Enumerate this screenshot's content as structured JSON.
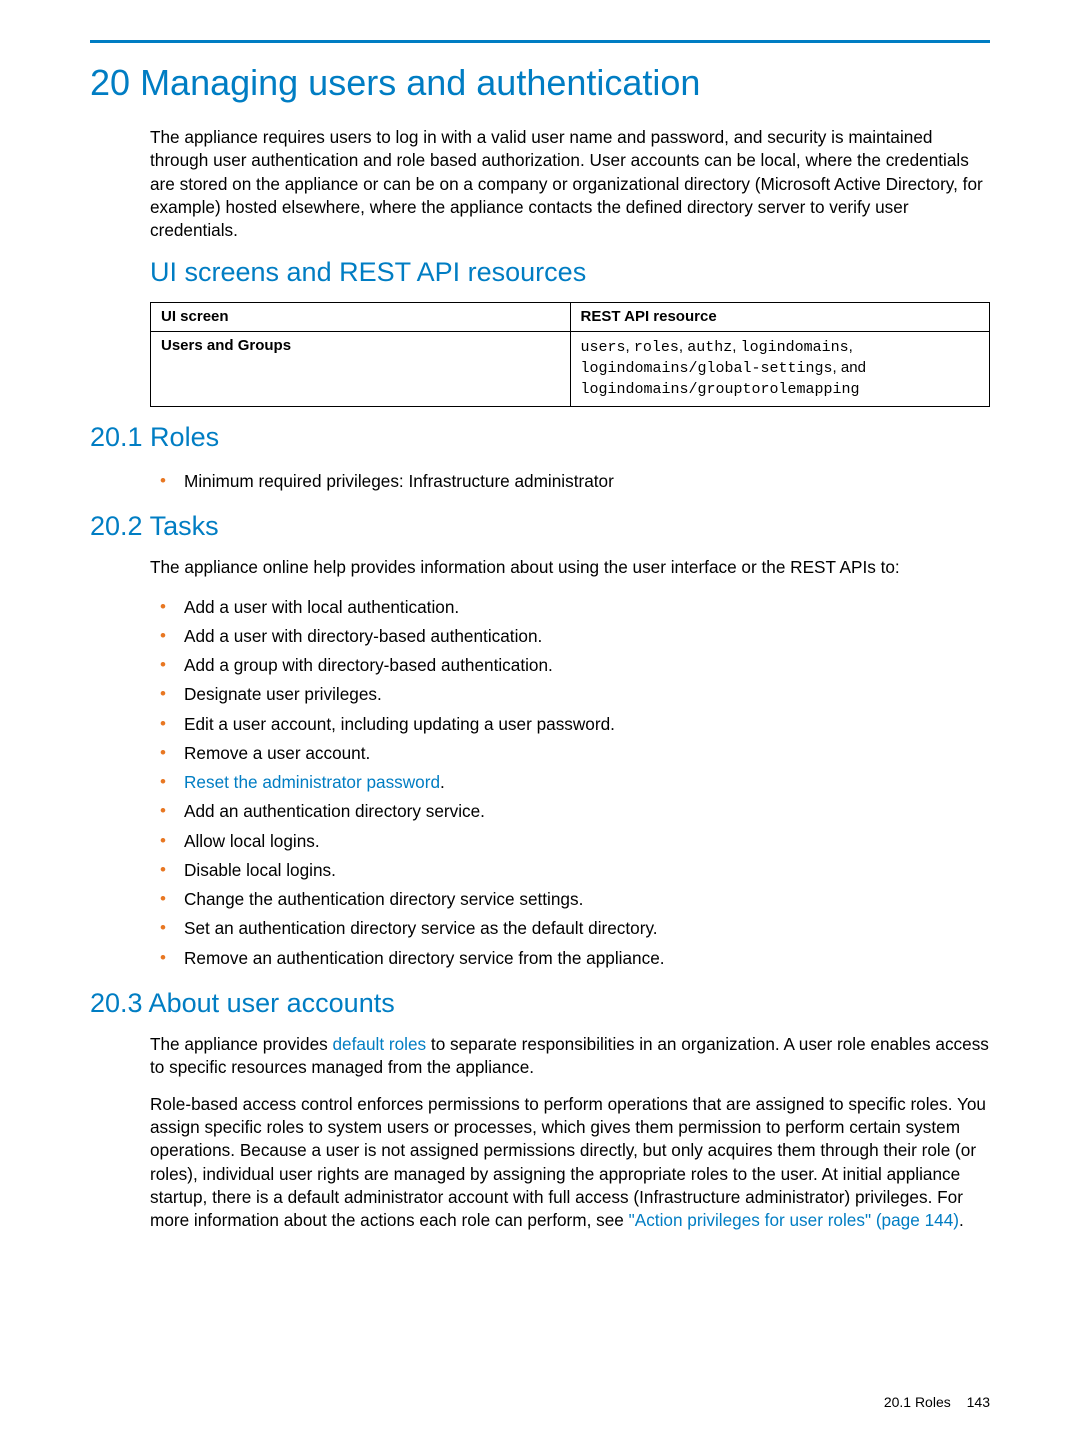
{
  "chapter": {
    "number": "20",
    "title": "Managing users and authentication"
  },
  "intro": "The appliance requires users to log in with a valid user name and password, and security is maintained through user authentication and role based authorization. User accounts can be local, where the credentials are stored on the appliance or can be on a company or organizational directory (Microsoft Active Directory, for example) hosted elsewhere, where the appliance contacts the defined directory server to verify user credentials.",
  "ui_rest_heading": "UI screens and REST API resources",
  "table": {
    "headers": {
      "ui": "UI screen",
      "rest": "REST API resource"
    },
    "row": {
      "ui": "Users and Groups",
      "rest_pre": "users",
      "rest_c1": ", ",
      "rest_r2": "roles",
      "rest_c2": ", ",
      "rest_r3": "authz",
      "rest_c3": ", ",
      "rest_r4": "logindomains",
      "rest_c4": ", ",
      "rest_r5": "logindomains/global-settings",
      "rest_c5": ", and ",
      "rest_r6": "logindomains/grouptorolemapping"
    }
  },
  "roles": {
    "heading": "20.1 Roles",
    "bullet": "Minimum required privileges: Infrastructure administrator"
  },
  "tasks": {
    "heading": "20.2 Tasks",
    "intro": "The appliance online help provides information about using the user interface or the REST APIs to:",
    "items": {
      "i0": "Add a user with local authentication.",
      "i1": "Add a user with directory-based authentication.",
      "i2": "Add a group with directory-based authentication.",
      "i3": "Designate user privileges.",
      "i4": "Edit a user account, including updating a user password.",
      "i5": "Remove a user account.",
      "i6_link": "Reset the administrator password",
      "i6_after": ".",
      "i7": "Add an authentication directory service.",
      "i8": "Allow local logins.",
      "i9": "Disable local logins.",
      "i10": "Change the authentication directory service settings.",
      "i11": "Set an authentication directory service as the default directory.",
      "i12": "Remove an authentication directory service from the appliance."
    }
  },
  "about": {
    "heading": "20.3 About user accounts",
    "p1_pre": "The appliance provides ",
    "p1_link": "default roles",
    "p1_post": " to separate responsibilities in an organization. A user role enables access to specific resources managed from the appliance.",
    "p2_pre": "Role-based access control enforces permissions to perform operations that are assigned to specific roles. You assign specific roles to system users or processes, which gives them permission to perform certain system operations. Because a user is not assigned permissions directly, but only acquires them through their role (or roles), individual user rights are managed by assigning the appropriate roles to the user. At initial appliance startup, there is a default administrator account with full access (Infrastructure administrator) privileges. For more information about the actions each role can perform, see ",
    "p2_link": "\"Action privileges for user roles\" (page 144)",
    "p2_post": "."
  },
  "footer": {
    "section": "20.1 Roles",
    "page": "143"
  }
}
